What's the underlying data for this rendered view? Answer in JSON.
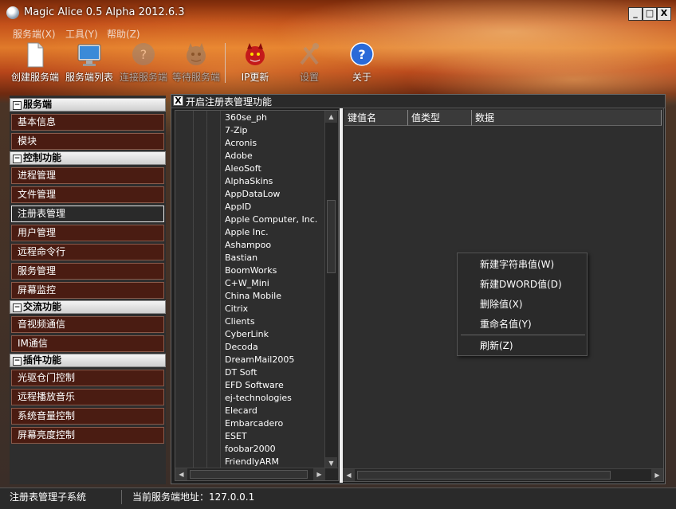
{
  "window": {
    "title": "Magic Alice 0.5 Alpha 2012.6.3",
    "controls": {
      "minimize": "_",
      "maximize": "□",
      "close": "X"
    }
  },
  "menubar": {
    "items": [
      "服务端(X)",
      "工具(Y)",
      "帮助(Z)"
    ]
  },
  "toolbar": {
    "buttons": [
      {
        "label": "创建服务端",
        "icon": "document-icon",
        "enabled": true
      },
      {
        "label": "服务端列表",
        "icon": "monitor-icon",
        "enabled": true
      },
      {
        "label": "连接服务端",
        "icon": "connect-help-icon",
        "enabled": false
      },
      {
        "label": "等待服务端",
        "icon": "devil-icon",
        "enabled": false
      },
      {
        "label": "IP更新",
        "icon": "devil-red-icon",
        "enabled": true
      },
      {
        "label": "设置",
        "icon": "tools-icon",
        "enabled": false
      },
      {
        "label": "关于",
        "icon": "help-icon",
        "enabled": true
      }
    ]
  },
  "sidebar": {
    "groups": [
      {
        "title": "服务端",
        "items": [
          "基本信息",
          "模块"
        ]
      },
      {
        "title": "控制功能",
        "items": [
          "进程管理",
          "文件管理",
          "注册表管理",
          "用户管理",
          "远程命令行",
          "服务管理",
          "屏幕监控"
        ]
      },
      {
        "title": "交流功能",
        "items": [
          "音视频通信",
          "IM通信"
        ]
      },
      {
        "title": "插件功能",
        "items": [
          "光驱仓门控制",
          "远程播放音乐",
          "系统音量控制",
          "屏幕亮度控制"
        ]
      }
    ],
    "active_item": "注册表管理"
  },
  "panel": {
    "close_label": "X",
    "title": "开启注册表管理功能"
  },
  "registry_tree": {
    "items": [
      "360se_ph",
      "7-Zip",
      "Acronis",
      "Adobe",
      "AleoSoft",
      "AlphaSkins",
      "AppDataLow",
      "AppID",
      "Apple Computer, Inc.",
      "Apple Inc.",
      "Ashampoo",
      "Bastian",
      "BoomWorks",
      "C+W_Mini",
      "China Mobile",
      "Citrix",
      "Clients",
      "CyberLink",
      "Decoda",
      "DreamMail2005",
      "DT Soft",
      "EFD Software",
      "ej-technologies",
      "Elecard",
      "Embarcadero",
      "ESET",
      "foobar2000",
      "FriendlyARM"
    ]
  },
  "value_list": {
    "columns": [
      "键值名",
      "值类型",
      "数据"
    ]
  },
  "context_menu": {
    "items": [
      "新建字符串值(W)",
      "新建DWORD值(D)",
      "删除值(X)",
      "重命名值(Y)",
      "刷新(Z)"
    ]
  },
  "statusbar": {
    "subsystem": "注册表管理子系统",
    "server_address": "当前服务端地址：127.0.0.1"
  }
}
